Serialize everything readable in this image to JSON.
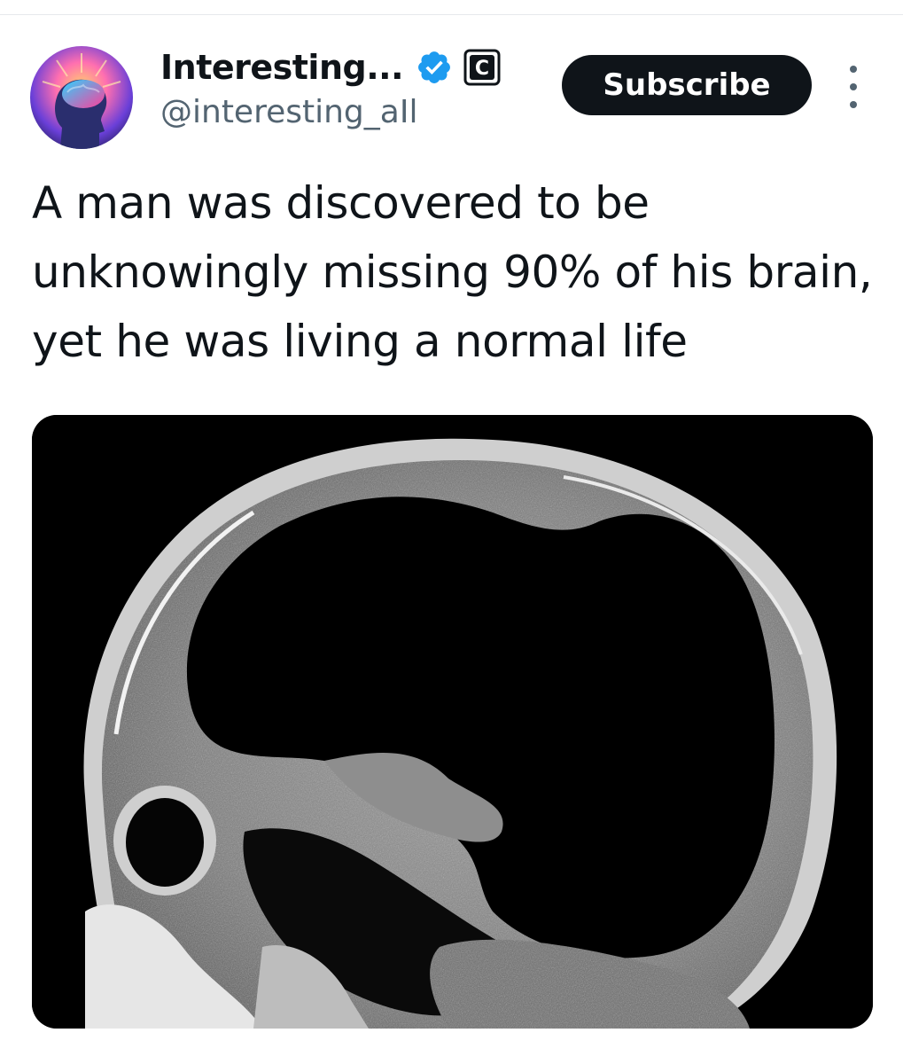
{
  "post": {
    "author": {
      "display_name": "Interesting...",
      "handle": "@interesting_aIl",
      "verified_icon": "verified-badge-icon",
      "affiliate_badge_letter": "C"
    },
    "subscribe_label": "Subscribe",
    "more_icon": "more-vertical-icon",
    "text": "A man was discovered to be unknowingly missing 90% of his brain, yet he was living a normal life",
    "media": {
      "icon": "mri-scan-image"
    }
  },
  "colors": {
    "text_primary": "#0f1419",
    "text_secondary": "#536471",
    "verified_blue": "#1d9bf0",
    "button_bg": "#0f1419",
    "button_text": "#ffffff"
  }
}
